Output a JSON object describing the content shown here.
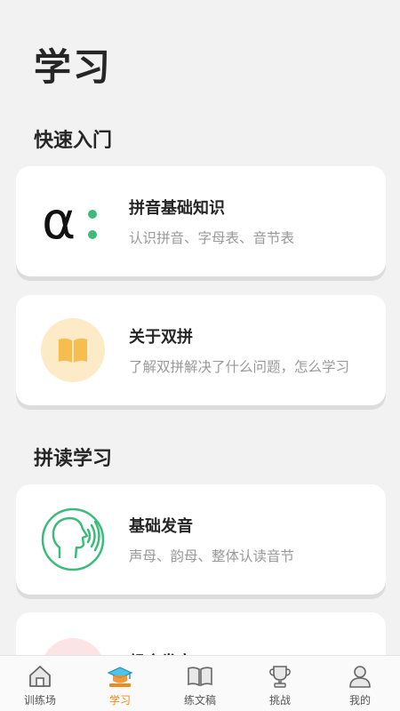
{
  "header": {
    "title": "学习"
  },
  "sections": {
    "quick_start": "快速入门",
    "spelling": "拼读学习"
  },
  "cards": [
    {
      "title": "拼音基础知识",
      "desc": "认识拼音、字母表、音节表",
      "icon": "alpha-icon"
    },
    {
      "title": "关于双拼",
      "desc": "了解双拼解决了什么问题，怎么学习",
      "icon": "book-icon"
    },
    {
      "title": "基础发音",
      "desc": "声母、韵母、整体认读音节",
      "icon": "speaking-head-icon"
    },
    {
      "title": "组合发音",
      "desc": "",
      "icon": "combo-icon"
    }
  ],
  "tabbar": {
    "items": [
      {
        "label": "训练场",
        "icon": "house-icon"
      },
      {
        "label": "学习",
        "icon": "graduation-cap-icon",
        "active": true
      },
      {
        "label": "练文稿",
        "icon": "open-book-icon"
      },
      {
        "label": "挑战",
        "icon": "trophy-icon"
      },
      {
        "label": "我的",
        "icon": "user-icon"
      }
    ]
  },
  "colors": {
    "accent": "#f08a1c",
    "green": "#3dbb7a",
    "book_bg": "#fdebc8",
    "book": "#f7bd4f"
  }
}
